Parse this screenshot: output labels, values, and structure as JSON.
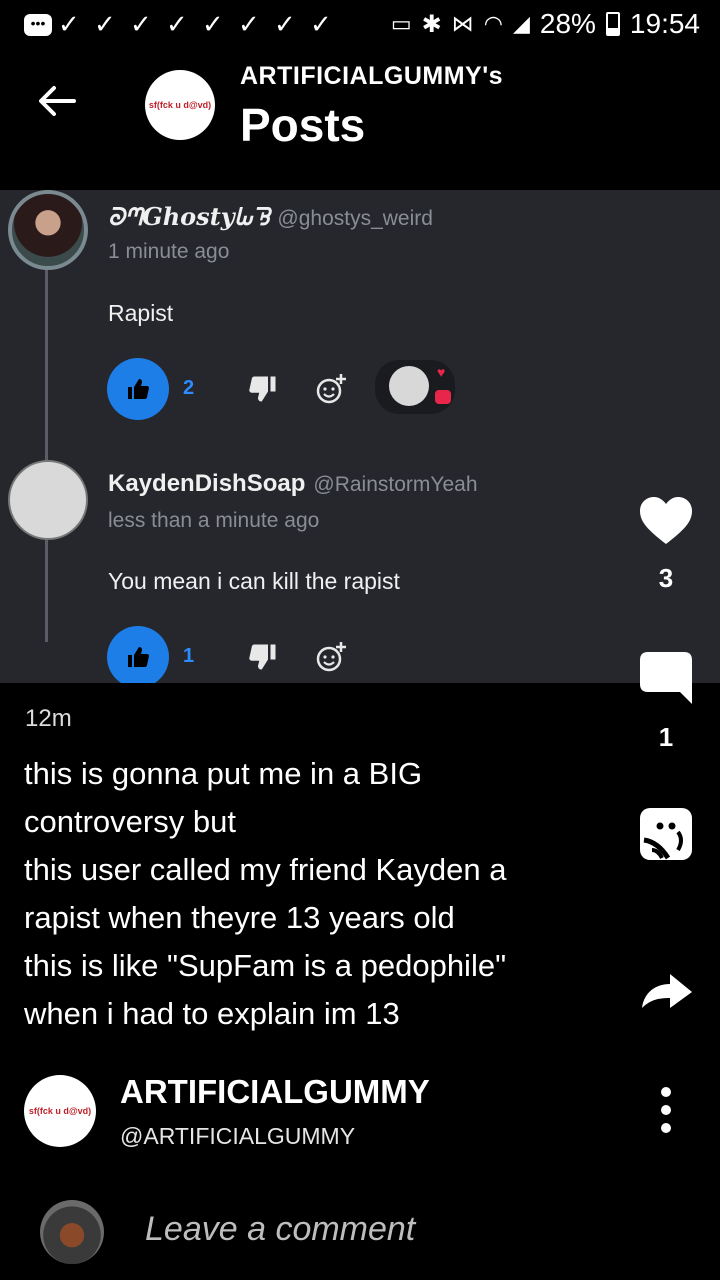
{
  "status_bar": {
    "battery": "28%",
    "time": "19:54"
  },
  "header": {
    "subtitle": "ARTIFICIALGUMMY's",
    "title": "Posts",
    "avatar_text": "sf(fck u d@vd)"
  },
  "screenshot": {
    "comments": [
      {
        "name": "ᘐᘉGhostyᘈᘋ",
        "handle": "@ghostys_weird",
        "time": "1 minute ago",
        "text": "Rapist",
        "likes": "2"
      },
      {
        "name": "KaydenDishSoap",
        "handle": "@RainstormYeah",
        "time": "less than a minute ago",
        "text": "You mean i can kill the rapist",
        "likes": "1"
      }
    ]
  },
  "side_actions": {
    "like_count": "3",
    "comment_count": "1"
  },
  "post": {
    "time": "12m",
    "lines": [
      "this is gonna put me in a BIG",
      "controversy but",
      "this user called my friend Kayden a",
      "rapist when theyre 13 years old",
      "this is like \"SupFam is a pedophile\"",
      "when i had to explain im 13"
    ]
  },
  "author": {
    "name": "ARTIFICIALGUMMY",
    "handle": "@ARTIFICIALGUMMY",
    "avatar_text": "sf(fck u d@vd)"
  },
  "comment_bar": {
    "placeholder": "Leave a comment"
  },
  "colors": {
    "background": "#000000",
    "card": "#25272d",
    "like_blue": "#1e7ee8"
  }
}
